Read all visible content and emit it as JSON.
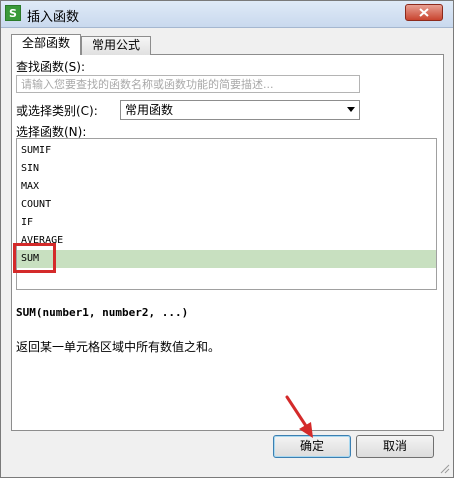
{
  "window": {
    "title": "插入函数",
    "app_icon": "spreadsheet-s-icon",
    "close_icon": "close-icon"
  },
  "tabs": [
    {
      "label": "全部函数",
      "active": true
    },
    {
      "label": "常用公式",
      "active": false
    }
  ],
  "search": {
    "label": "查找函数(S):",
    "placeholder": "请输入您要查找的函数名称或函数功能的简要描述...",
    "value": ""
  },
  "category": {
    "label": "或选择类别(C):",
    "selected": "常用函数",
    "icon": "chevron-down-icon"
  },
  "function_list": {
    "label": "选择函数(N):",
    "items": [
      "SUMIF",
      "SIN",
      "MAX",
      "COUNT",
      "IF",
      "AVERAGE",
      "SUM"
    ],
    "selected_index": 6
  },
  "details": {
    "signature": "SUM(number1, number2, ...)",
    "description": "返回某一单元格区域中所有数值之和。"
  },
  "buttons": {
    "ok": "确定",
    "cancel": "取消"
  },
  "colors": {
    "selected_row": "#c8e0c0",
    "annotation_red": "#d42a2a",
    "close_button": "#c9442f"
  }
}
